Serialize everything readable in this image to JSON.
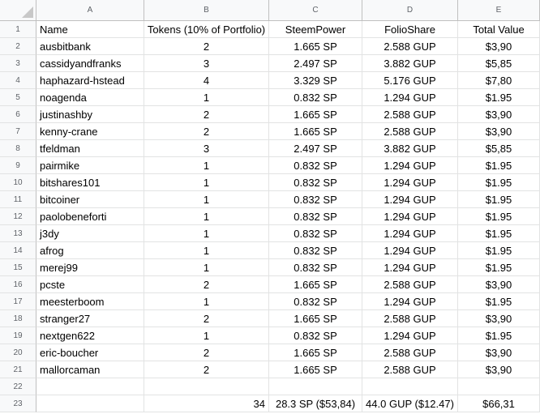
{
  "columns": [
    "A",
    "B",
    "C",
    "D",
    "E"
  ],
  "header_row": [
    "Name",
    "Tokens (10% of Portfolio)",
    "SteemPower",
    "FolioShare",
    "Total Value"
  ],
  "rows": [
    [
      "ausbitbank",
      "2",
      "1.665 SP",
      "2.588 GUP",
      "$3,90"
    ],
    [
      "cassidyandfranks",
      "3",
      "2.497 SP",
      "3.882 GUP",
      "$5,85"
    ],
    [
      "haphazard-hstead",
      "4",
      "3.329 SP",
      "5.176 GUP",
      "$7,80"
    ],
    [
      "noagenda",
      "1",
      "0.832 SP",
      "1.294 GUP",
      "$1.95"
    ],
    [
      "justinashby",
      "2",
      "1.665 SP",
      "2.588 GUP",
      "$3,90"
    ],
    [
      "kenny-crane",
      "2",
      "1.665 SP",
      "2.588 GUP",
      "$3,90"
    ],
    [
      "tfeldman",
      "3",
      "2.497 SP",
      "3.882 GUP",
      "$5,85"
    ],
    [
      "pairmike",
      "1",
      "0.832 SP",
      "1.294 GUP",
      "$1.95"
    ],
    [
      "bitshares101",
      "1",
      "0.832 SP",
      "1.294 GUP",
      "$1.95"
    ],
    [
      "bitcoiner",
      "1",
      "0.832 SP",
      "1.294 GUP",
      "$1.95"
    ],
    [
      "paolobeneforti",
      "1",
      "0.832 SP",
      "1.294 GUP",
      "$1.95"
    ],
    [
      "j3dy",
      "1",
      "0.832 SP",
      "1.294 GUP",
      "$1.95"
    ],
    [
      "afrog",
      "1",
      "0.832 SP",
      "1.294 GUP",
      "$1.95"
    ],
    [
      "merej99",
      "1",
      "0.832 SP",
      "1.294 GUP",
      "$1.95"
    ],
    [
      "pcste",
      "2",
      "1.665 SP",
      "2.588 GUP",
      "$3,90"
    ],
    [
      "meesterboom",
      "1",
      "0.832 SP",
      "1.294 GUP",
      "$1.95"
    ],
    [
      "stranger27",
      "2",
      "1.665 SP",
      "2.588 GUP",
      "$3,90"
    ],
    [
      "nextgen622",
      "1",
      "0.832 SP",
      "1.294 GUP",
      "$1.95"
    ],
    [
      "eric-boucher",
      "2",
      "1.665 SP",
      "2.588 GUP",
      "$3,90"
    ],
    [
      "mallorcaman",
      "2",
      "1.665 SP",
      "2.588 GUP",
      "$3,90"
    ]
  ],
  "empty_row": [
    "",
    "",
    "",
    "",
    ""
  ],
  "total_row": [
    "",
    "34",
    "28.3 SP ($53,84)",
    "44.0 GUP ($12.47)",
    "$66,31"
  ],
  "row_numbers": [
    "1",
    "2",
    "3",
    "4",
    "5",
    "6",
    "7",
    "8",
    "9",
    "10",
    "11",
    "12",
    "13",
    "14",
    "15",
    "16",
    "17",
    "18",
    "19",
    "20",
    "21",
    "22",
    "23"
  ]
}
